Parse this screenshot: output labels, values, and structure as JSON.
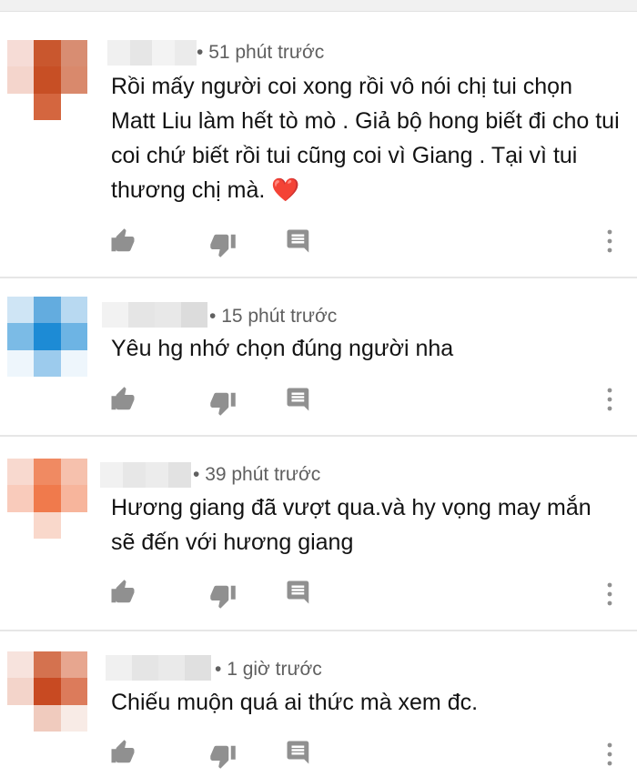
{
  "comments": [
    {
      "time": "51 phút trước",
      "text": "Rồi mấy người coi xong rồi vô nói chị tui chọn Matt Liu làm hết tò mò . Giả bộ hong biết đi cho tui coi chứ biết rồi tui cũng coi vì  Giang . Tại vì tui thương chị mà. ❤️",
      "avatar_colors": [
        "#f6dcd6",
        "#c9572e",
        "#d88d72",
        "#f4d5cc",
        "#c74f25",
        "#d9896c",
        "#ffffff",
        "#d4663f",
        "#ffffff"
      ],
      "name_colors": [
        "#f0f0f0",
        "#e6e6e6",
        "#f3f3f3",
        "#ebebeb"
      ]
    },
    {
      "time": "15 phút trước",
      "text": "Yêu hg nhớ chọn đúng người nha",
      "avatar_colors": [
        "#cfe5f5",
        "#63acdf",
        "#b8d9f1",
        "#7bbbe6",
        "#1d8bd5",
        "#6db4e4",
        "#eef6fc",
        "#9ccbed",
        "#eef6fc"
      ],
      "name_colors": [
        "#f2f2f2",
        "#e5e5e5",
        "#e8e8e8",
        "#dcdcdc"
      ]
    },
    {
      "time": "39 phút trước",
      "text": "Hương giang đã vượt qua.và hy vọng may mắn sẽ đến với hương giang",
      "avatar_colors": [
        "#f8d9cf",
        "#f08a62",
        "#f6c1ad",
        "#f9cbbb",
        "#f07a4c",
        "#f7b59c",
        "#ffffff",
        "#f9d8cb",
        "#ffffff"
      ],
      "name_colors": [
        "#f1f1f1",
        "#e7e7e7",
        "#ececec",
        "#e2e2e2"
      ]
    },
    {
      "time": "1 giờ trước",
      "text": "Chiếu muộn quá ai thức mà xem đc.",
      "avatar_colors": [
        "#f7e3dd",
        "#d4724f",
        "#e7a68f",
        "#f3d4ca",
        "#c84a22",
        "#dc7b5b",
        "#ffffff",
        "#f0cbbe",
        "#f8ebe6"
      ],
      "name_colors": [
        "#f0f0f0",
        "#e5e5e5",
        "#eaeaea",
        "#e0e0e0"
      ]
    }
  ],
  "icons": {
    "like": "thumbs-up-icon",
    "dislike": "thumbs-down-icon",
    "reply": "reply-icon",
    "more": "more-vert-icon"
  },
  "colors": {
    "meta": "#606060",
    "icon": "#909090",
    "divider": "#e6e6e6"
  }
}
